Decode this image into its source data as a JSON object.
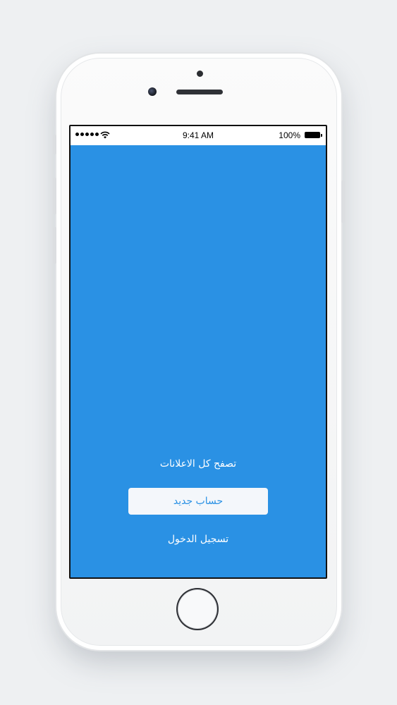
{
  "status_bar": {
    "time": "9:41 AM",
    "battery_percent": "100%",
    "signal_bars": 5
  },
  "main": {
    "browse_all_ads_label": "تصفح كل الاعلانات",
    "new_account_label": "حساب جديد",
    "login_label": "تسجيل الدخول"
  },
  "colors": {
    "background": "#2a91e4",
    "button_background": "#f4f7fb",
    "button_text": "#2a91e4",
    "link_text": "#ffffff"
  },
  "icons": {
    "signal": "signal-icon",
    "wifi": "wifi-icon",
    "battery": "battery-icon"
  }
}
